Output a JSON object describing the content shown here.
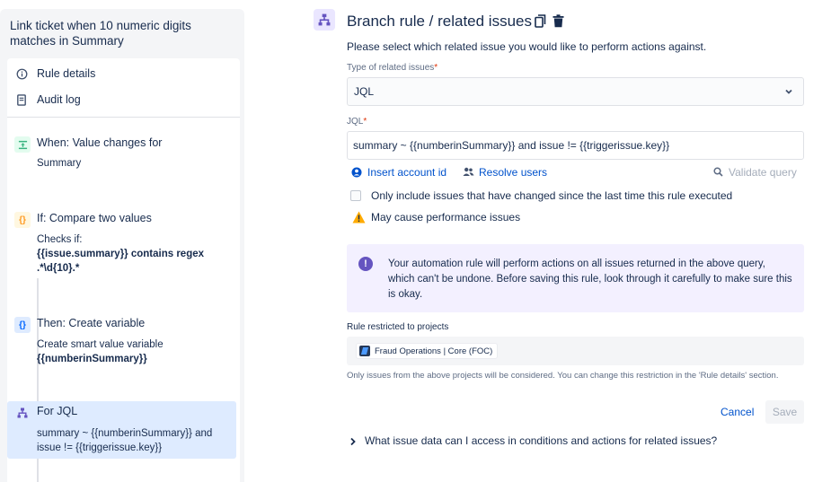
{
  "sidebar": {
    "rule_title": "Link ticket when 10 numeric digits matches in Summary",
    "nav": [
      {
        "label": "Rule details",
        "icon": "info-icon"
      },
      {
        "label": "Audit log",
        "icon": "document-icon"
      }
    ],
    "steps": [
      {
        "title": "When: Value changes for",
        "desc": "Summary",
        "icon": "trigger-icon",
        "color": "#36b37e"
      },
      {
        "title": "If: Compare two values",
        "desc_prefix": "Checks if:",
        "desc_bold": "{{issue.summary}} contains regex .*\\d{10}.*",
        "icon": "condition-icon",
        "color": "#ffab00"
      },
      {
        "title": "Then: Create variable",
        "desc_prefix": "Create smart value variable",
        "desc_bold": "{{numberinSummary}}",
        "icon": "action-icon",
        "color": "#0065ff"
      },
      {
        "title": "For JQL",
        "desc": "summary ~ {{numberinSummary}} and issue != {{triggerissue.key}}",
        "icon": "branch-icon",
        "color": "#6554c0"
      }
    ]
  },
  "main": {
    "title": "Branch rule / related issues",
    "instruction": "Please select which related issue you would like to perform actions against.",
    "type_label": "Type of related issues",
    "required_mark": "*",
    "type_value": "JQL",
    "jql_label": "JQL",
    "jql_value": "summary ~ {{numberinSummary}} and issue != {{triggerissue.key}}",
    "insert_account_label": "Insert account id",
    "resolve_users_label": "Resolve users",
    "validate_label": "Validate query",
    "checkbox_label": "Only include issues that have changed since the last time this rule executed",
    "checkbox_checked": false,
    "warning_text": "May cause performance issues",
    "info_text": "Your automation rule will perform actions on all issues returned in the above query, which can't be undone. Before saving this rule, look through it carefully to make sure this is okay.",
    "restricted_label": "Rule restricted to projects",
    "project_chip": "Fraud Operations | Core (FOC)",
    "help_text": "Only issues from the above projects will be considered. You can change this restriction in the 'Rule details' section.",
    "cancel_label": "Cancel",
    "save_label": "Save",
    "faq_label": "What issue data can I access in conditions and actions for related issues?"
  },
  "colors": {
    "link": "#0052cc",
    "accent_purple": "#6554c0",
    "info_bg": "#f3f0ff",
    "warning": "#ffab00",
    "active_step_bg": "#deebff"
  }
}
